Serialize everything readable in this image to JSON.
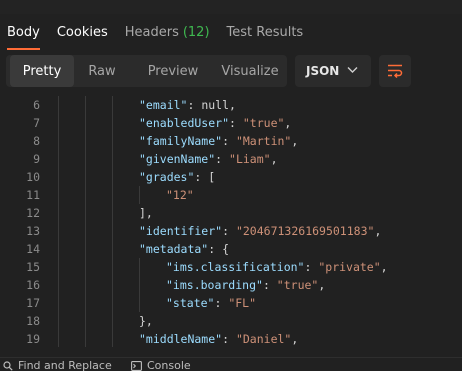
{
  "tabs": [
    {
      "label": "Body"
    },
    {
      "label": "Cookies"
    },
    {
      "label": "Headers",
      "count": "(12)"
    },
    {
      "label": "Test Results"
    }
  ],
  "view_modes": {
    "pretty": "Pretty",
    "raw": "Raw",
    "preview": "Preview",
    "visualize": "Visualize",
    "selected": "Pretty"
  },
  "format": "JSON",
  "icons": {
    "format_chevron": "chevron-down-icon",
    "wrap": "text-wrap-icon",
    "find": "magnifier-icon",
    "console": "console-icon"
  },
  "colors": {
    "accent": "#ff6c37",
    "count": "#3fb950",
    "json_key": "#9cdcfe",
    "json_string": "#ce9178",
    "json_punct": "#d4d4d4",
    "line_number": "#8b8b8b"
  },
  "code_lines": [
    {
      "n": "6",
      "key": "\"email\"",
      "sep": ": ",
      "val": "null,",
      "depth": 4,
      "val_kind": "p"
    },
    {
      "n": "7",
      "key": "\"enabledUser\"",
      "sep": ": ",
      "val": "\"true\"",
      "tail": ",",
      "depth": 4,
      "val_kind": "s"
    },
    {
      "n": "8",
      "key": "\"familyName\"",
      "sep": ": ",
      "val": "\"Martin\"",
      "tail": ",",
      "depth": 4,
      "val_kind": "s"
    },
    {
      "n": "9",
      "key": "\"givenName\"",
      "sep": ": ",
      "val": "\"Liam\"",
      "tail": ",",
      "depth": 4,
      "val_kind": "s"
    },
    {
      "n": "10",
      "key": "\"grades\"",
      "sep": ": ",
      "val": "[",
      "depth": 4,
      "val_kind": "p"
    },
    {
      "n": "11",
      "key": "",
      "sep": "",
      "val": "\"12\"",
      "depth": 5,
      "val_kind": "s"
    },
    {
      "n": "12",
      "key": "",
      "sep": "",
      "val": "],",
      "depth": 4,
      "val_kind": "p"
    },
    {
      "n": "13",
      "key": "\"identifier\"",
      "sep": ": ",
      "val": "\"204671326169501183\"",
      "tail": ",",
      "depth": 4,
      "val_kind": "s"
    },
    {
      "n": "14",
      "key": "\"metadata\"",
      "sep": ": ",
      "val": "{",
      "depth": 4,
      "val_kind": "p"
    },
    {
      "n": "15",
      "key": "\"ims.classification\"",
      "sep": ": ",
      "val": "\"private\"",
      "tail": ",",
      "depth": 5,
      "val_kind": "s"
    },
    {
      "n": "16",
      "key": "\"ims.boarding\"",
      "sep": ": ",
      "val": "\"true\"",
      "tail": ",",
      "depth": 5,
      "val_kind": "s"
    },
    {
      "n": "17",
      "key": "\"state\"",
      "sep": ": ",
      "val": "\"FL\"",
      "depth": 5,
      "val_kind": "s"
    },
    {
      "n": "18",
      "key": "",
      "sep": "",
      "val": "},",
      "depth": 4,
      "val_kind": "p"
    },
    {
      "n": "19",
      "key": "\"middleName\"",
      "sep": ": ",
      "val": "\"Daniel\"",
      "tail": ",",
      "depth": 4,
      "val_kind": "s"
    }
  ],
  "bottom_bar": {
    "find": "Find and Replace",
    "console": "Console"
  }
}
